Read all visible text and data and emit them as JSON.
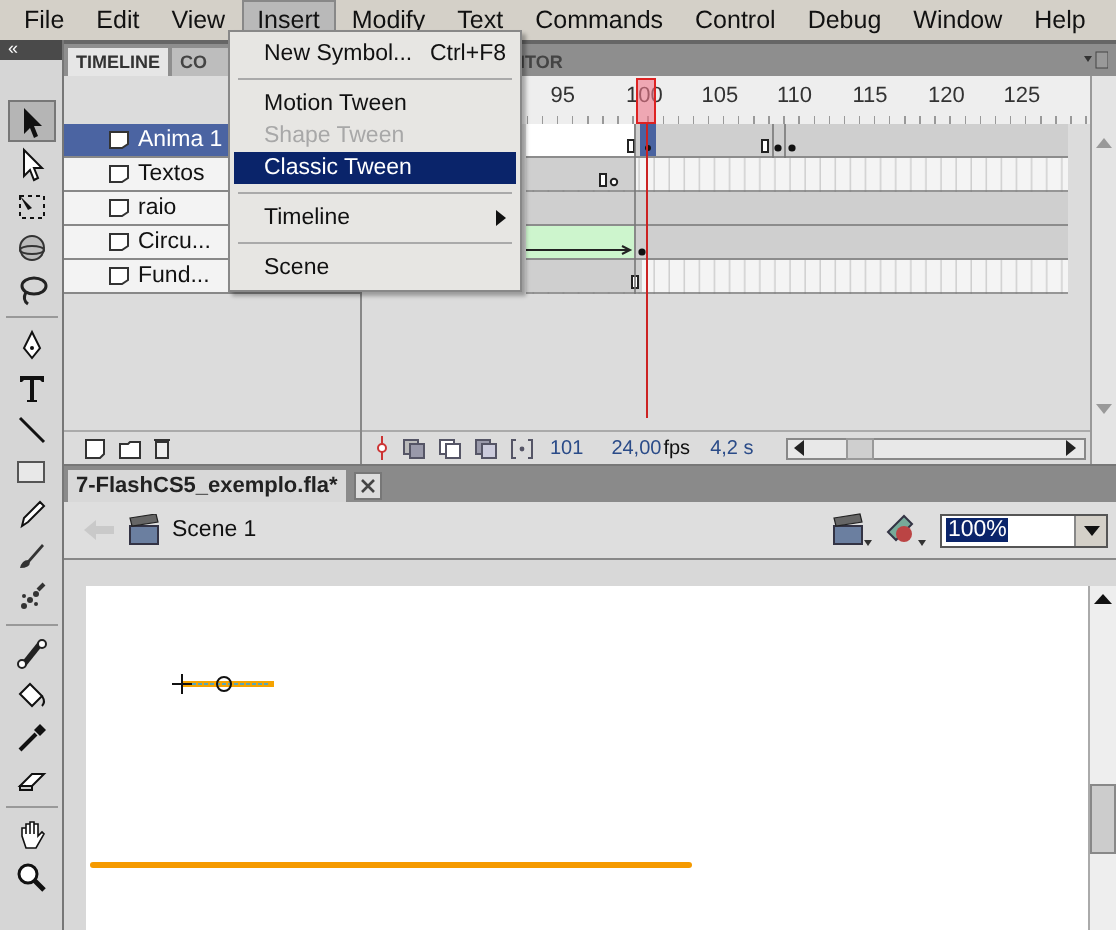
{
  "menu_bar": [
    {
      "label": "File",
      "selected": false
    },
    {
      "label": "Edit",
      "selected": false
    },
    {
      "label": "View",
      "selected": false
    },
    {
      "label": "Insert",
      "selected": true
    },
    {
      "label": "Modify",
      "selected": false
    },
    {
      "label": "Text",
      "selected": false
    },
    {
      "label": "Commands",
      "selected": false
    },
    {
      "label": "Control",
      "selected": false
    },
    {
      "label": "Debug",
      "selected": false
    },
    {
      "label": "Window",
      "selected": false
    },
    {
      "label": "Help",
      "selected": false
    }
  ],
  "insert_menu": [
    {
      "kind": "item",
      "label": "New Symbol...",
      "shortcut": "Ctrl+F8",
      "disabled": false,
      "selected": false,
      "submenu": false
    },
    {
      "kind": "separator"
    },
    {
      "kind": "item",
      "label": "Motion Tween",
      "disabled": false,
      "selected": false,
      "submenu": false
    },
    {
      "kind": "item",
      "label": "Shape Tween",
      "disabled": true,
      "selected": false,
      "submenu": false
    },
    {
      "kind": "item",
      "label": "Classic Tween",
      "disabled": false,
      "selected": true,
      "submenu": false
    },
    {
      "kind": "separator"
    },
    {
      "kind": "item",
      "label": "Timeline",
      "disabled": false,
      "selected": false,
      "submenu": true
    },
    {
      "kind": "separator"
    },
    {
      "kind": "item",
      "label": "Scene",
      "disabled": false,
      "selected": false,
      "submenu": false
    }
  ],
  "toolbar": {
    "collapse": "«"
  },
  "tools": [
    {
      "kind": "selection",
      "selected": true
    },
    {
      "kind": "subselection",
      "selected": false
    },
    {
      "kind": "transform",
      "selected": false
    },
    {
      "kind": "rotate3d",
      "selected": false
    },
    {
      "kind": "lasso",
      "selected": false
    },
    {
      "kind": "separator"
    },
    {
      "kind": "pen",
      "selected": false
    },
    {
      "kind": "text",
      "selected": false
    },
    {
      "kind": "line",
      "selected": false
    },
    {
      "kind": "rect",
      "selected": false
    },
    {
      "kind": "pencil",
      "selected": false
    },
    {
      "kind": "brush",
      "selected": false
    },
    {
      "kind": "deco",
      "selected": false
    },
    {
      "kind": "separator"
    },
    {
      "kind": "bone",
      "selected": false
    },
    {
      "kind": "bucket",
      "selected": false
    },
    {
      "kind": "eyedropper",
      "selected": false
    },
    {
      "kind": "eraser",
      "selected": false
    },
    {
      "kind": "separator"
    },
    {
      "kind": "hand",
      "selected": false
    },
    {
      "kind": "zoom",
      "selected": false
    }
  ],
  "timeline": {
    "tabs": [
      {
        "label": "TIMELINE",
        "selected": true
      },
      {
        "label": "CO",
        "selected": false
      },
      {
        "label": "ITOR",
        "selected": false
      }
    ],
    "ruler": [
      "95",
      "100",
      "105",
      "110",
      "115",
      "120",
      "125"
    ],
    "layers": [
      {
        "name": "Anima 1",
        "selected": true
      },
      {
        "name": "Textos",
        "selected": false
      },
      {
        "name": "raio",
        "selected": false
      },
      {
        "name": "Circu...",
        "selected": false
      },
      {
        "name": "Fund...",
        "selected": false
      }
    ],
    "status": {
      "frame": "101",
      "fps": "24,00",
      "fps_unit": "fps",
      "time": "4,2 s"
    }
  },
  "document": {
    "tab": "7-FlashCS5_exemplo.fla*",
    "scene": "Scene 1",
    "zoom": "100%"
  }
}
